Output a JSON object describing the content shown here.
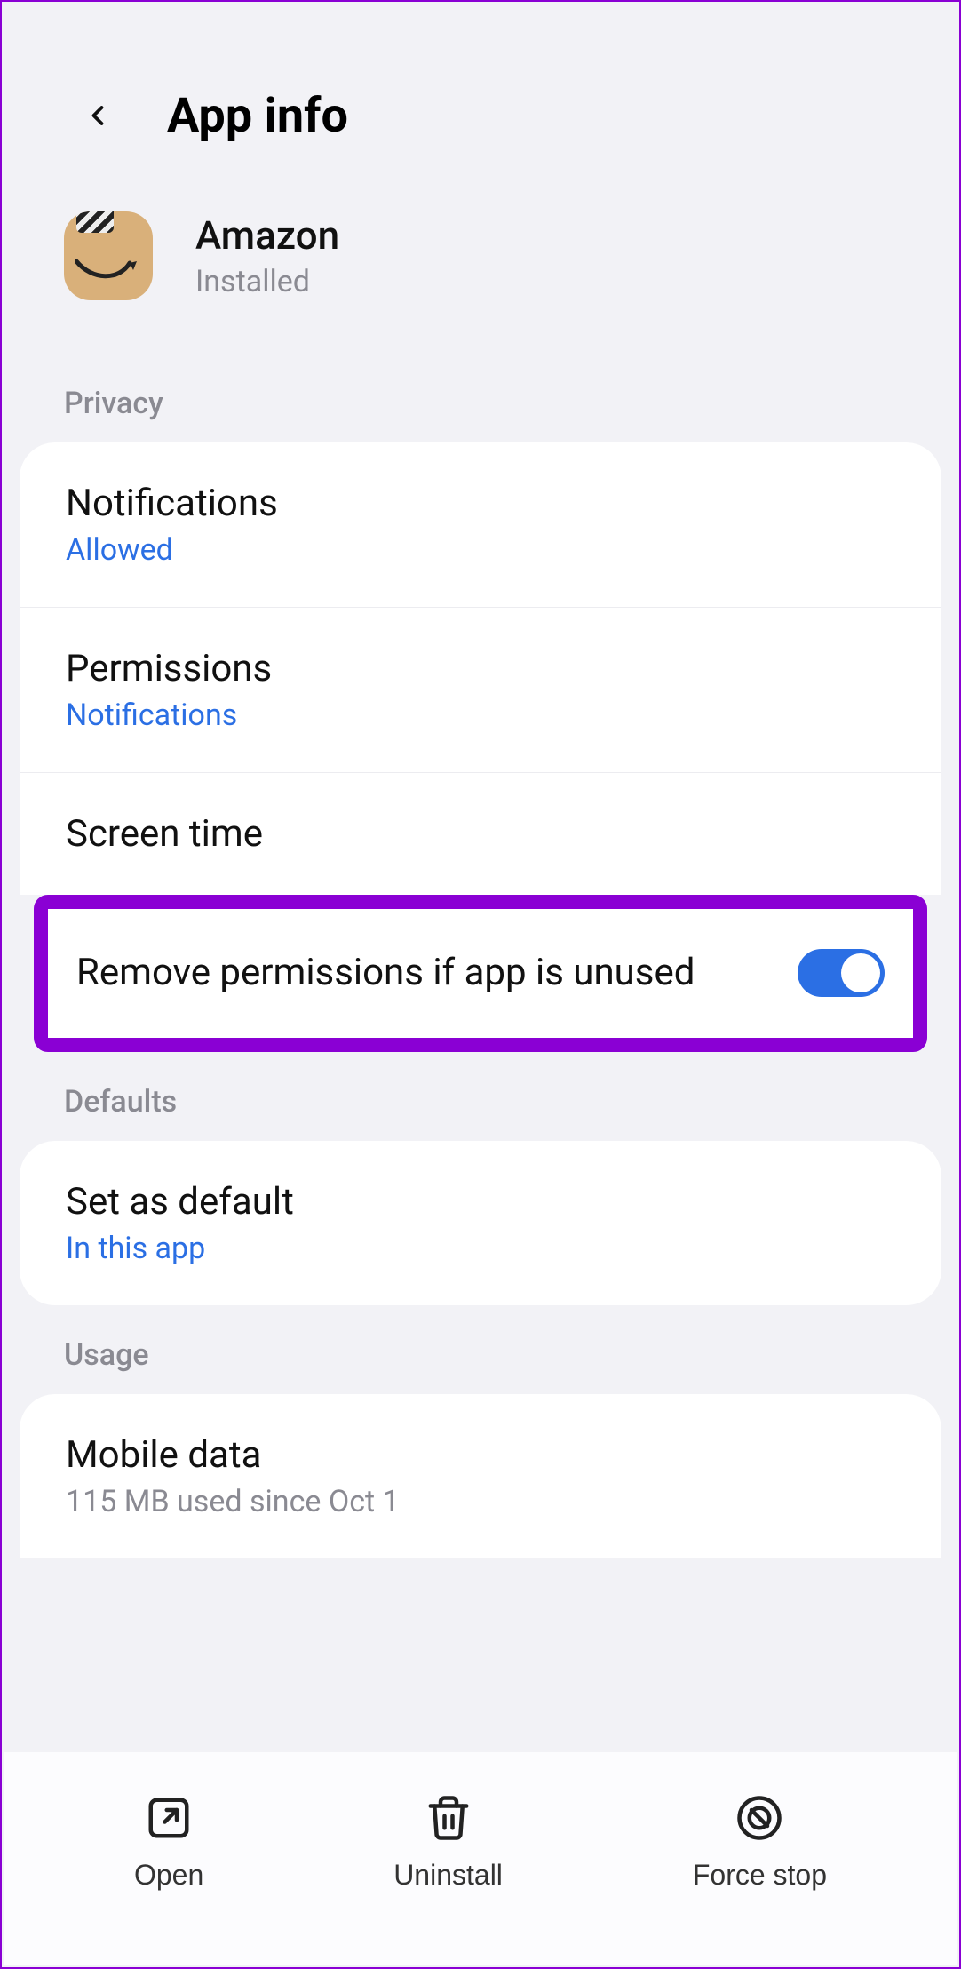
{
  "header": {
    "title": "App info"
  },
  "app": {
    "name": "Amazon",
    "status": "Installed"
  },
  "sections": {
    "privacy": {
      "label": "Privacy",
      "notifications": {
        "title": "Notifications",
        "sub": "Allowed"
      },
      "permissions": {
        "title": "Permissions",
        "sub": "Notifications"
      },
      "screentime": {
        "title": "Screen time"
      },
      "remove_perms": {
        "title": "Remove permissions if app is unused",
        "enabled": true
      }
    },
    "defaults": {
      "label": "Defaults",
      "set_default": {
        "title": "Set as default",
        "sub": "In this app"
      }
    },
    "usage": {
      "label": "Usage",
      "mobile_data": {
        "title": "Mobile data",
        "sub": "115 MB used since Oct 1"
      }
    }
  },
  "bottom": {
    "open": "Open",
    "uninstall": "Uninstall",
    "force_stop": "Force stop"
  }
}
